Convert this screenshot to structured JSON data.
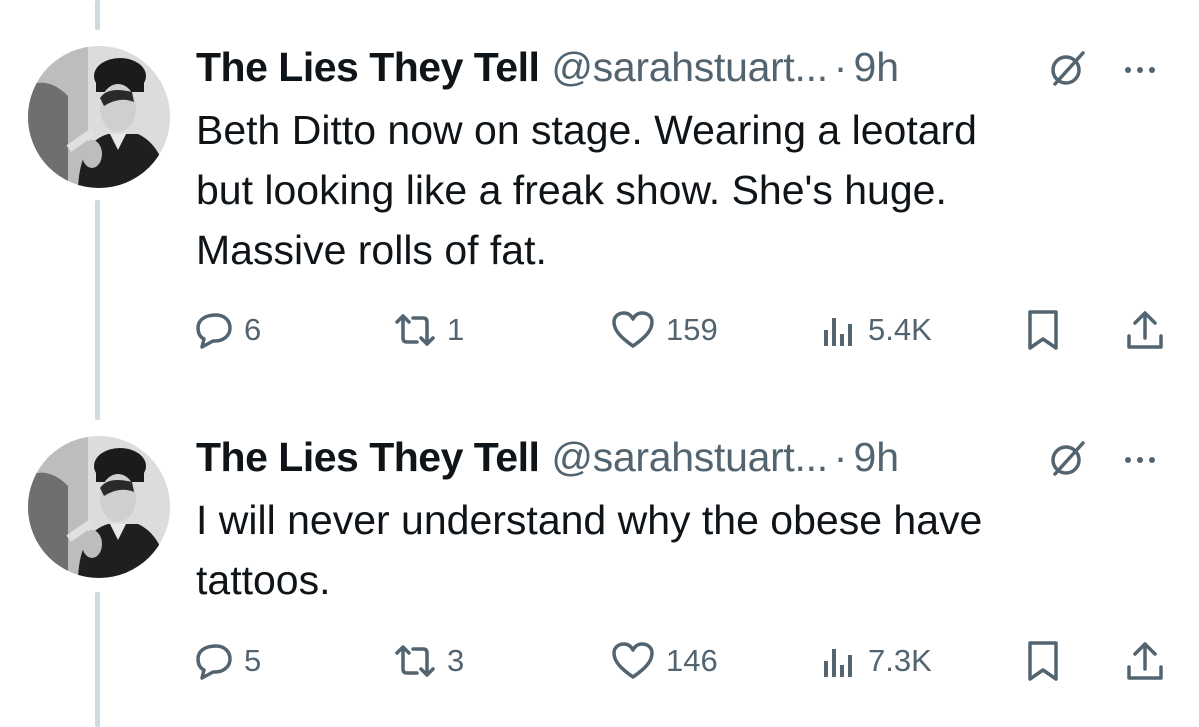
{
  "colors": {
    "text": "#0f1419",
    "secondary": "#536471",
    "thread_line": "#cfd9de"
  },
  "tweets": [
    {
      "author": "The Lies They Tell",
      "handle": "@sarahstuart...",
      "separator": "·",
      "time": "9h",
      "text": "Beth Ditto now on stage.  Wearing a leotard\nbut looking like a freak show.  She's huge.\nMassive rolls of fat.",
      "icons": [
        "grok-icon",
        "more-icon"
      ],
      "actions": {
        "replies": "6",
        "reposts": "1",
        "likes": "159",
        "views": "5.4K"
      }
    },
    {
      "author": "The Lies They Tell",
      "handle": "@sarahstuart...",
      "separator": "·",
      "time": "9h",
      "text": "I will never understand why the obese have\ntattoos.",
      "icons": [
        "grok-icon",
        "more-icon"
      ],
      "actions": {
        "replies": "5",
        "reposts": "3",
        "likes": "146",
        "views": "7.3K"
      }
    }
  ]
}
